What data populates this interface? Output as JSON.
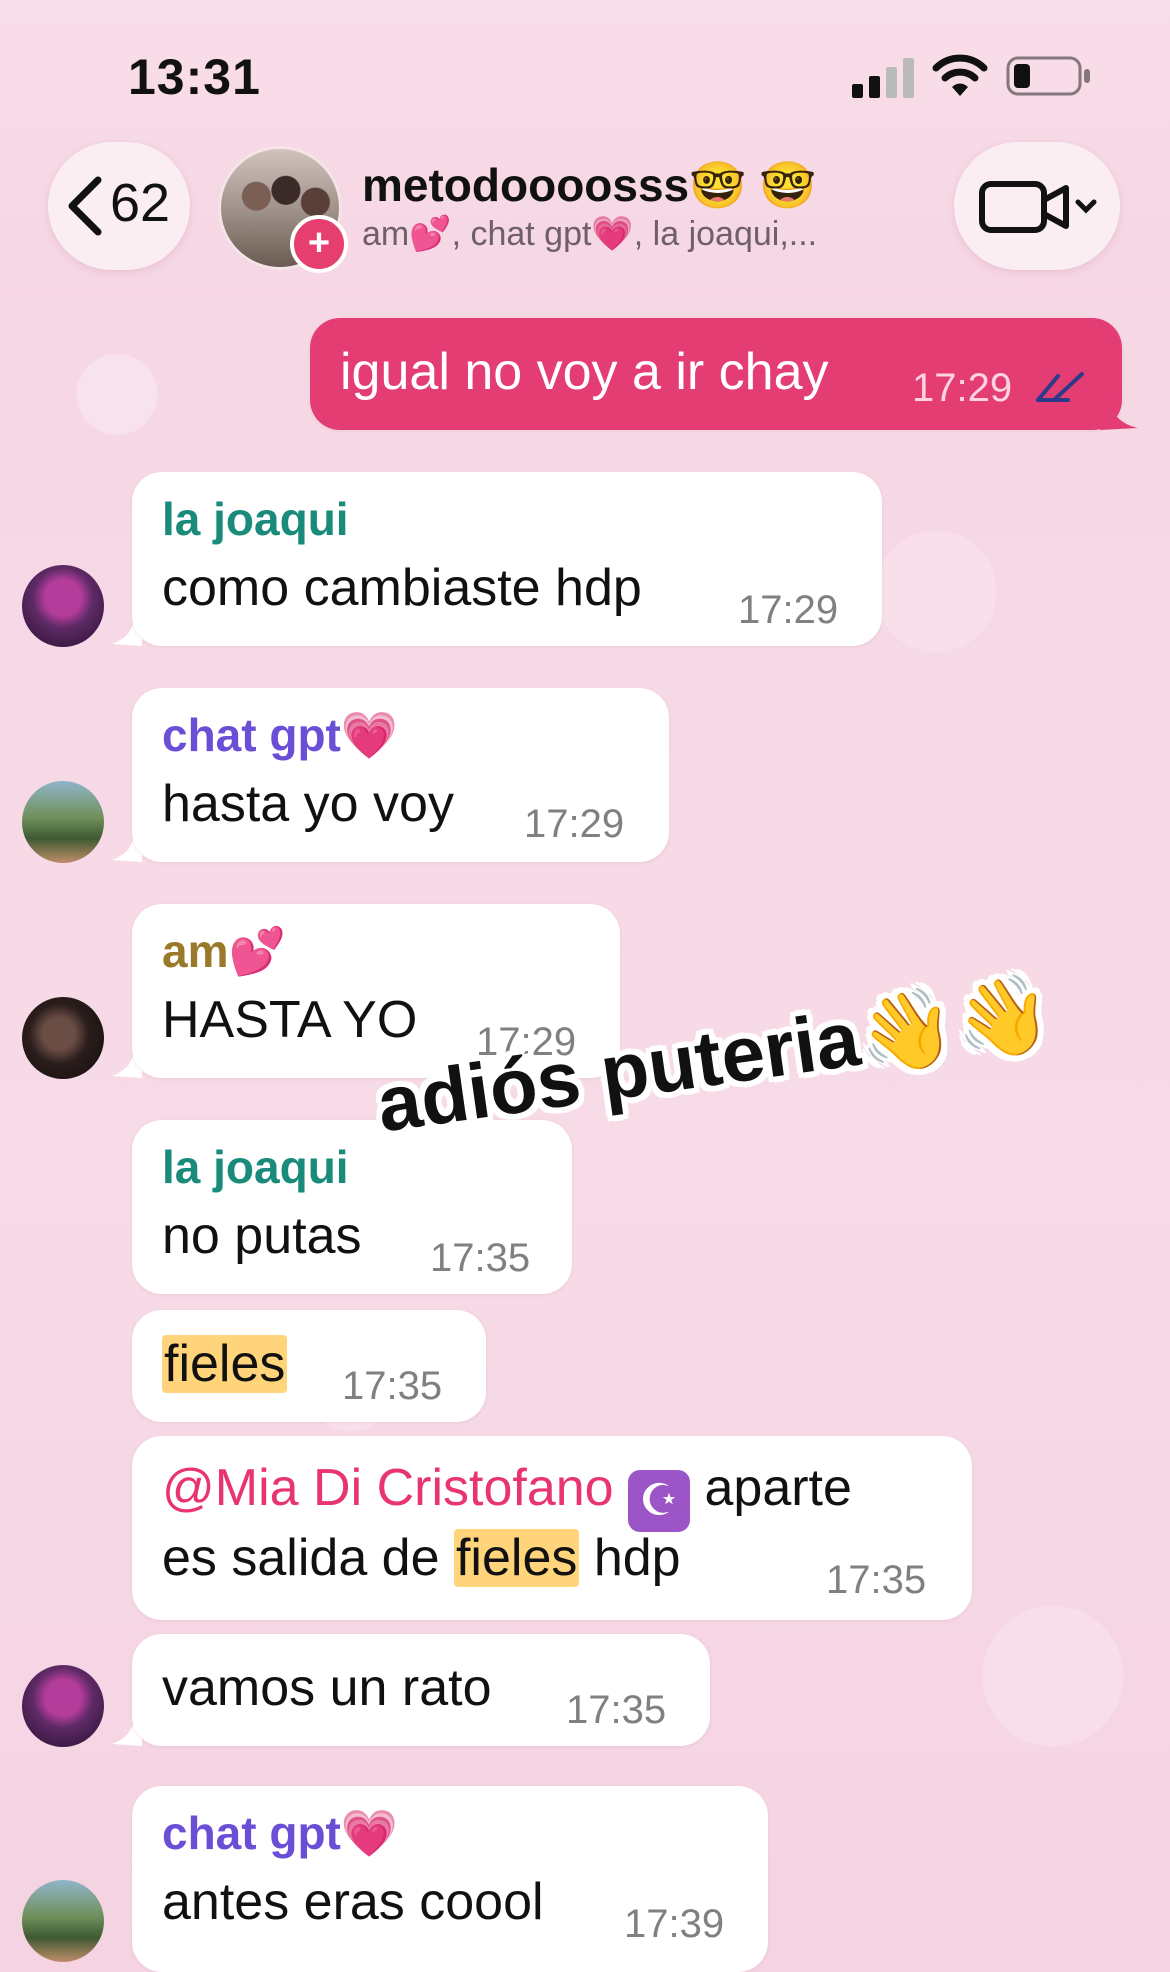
{
  "status_bar": {
    "time": "13:31"
  },
  "header": {
    "back_count": "62",
    "group_name": "metodoooosss🤓 🤓",
    "members": "am💕, chat gpt💗, la joaqui,..."
  },
  "messages": [
    {
      "id": "m1",
      "direction": "out",
      "text": "igual no voy a ir chay",
      "time": "17:29",
      "status": "read"
    },
    {
      "id": "m2",
      "sender": "la joaqui",
      "sender_color": "#1a8a7a",
      "text": "como cambiaste hdp",
      "time": "17:29"
    },
    {
      "id": "m3",
      "sender": "chat gpt💗",
      "sender_color": "#6a4fd6",
      "text": "hasta yo voy",
      "time": "17:29"
    },
    {
      "id": "m4",
      "sender": "am💕",
      "sender_color": "#9a7a2a",
      "text": "HASTA YO",
      "time": "17:29"
    },
    {
      "id": "m5",
      "sender": "la joaqui",
      "sender_color": "#1a8a7a",
      "text": "no putas",
      "time": "17:35"
    },
    {
      "id": "m6",
      "text_highlight": "fieles",
      "time": "17:35"
    },
    {
      "id": "m7",
      "mention": "@Mia Di Cristofano",
      "mention_badge": "☪",
      "line1_rest": "aparte",
      "line2_a": "es salida de",
      "line2_hl": "fieles",
      "line2_b": "hdp",
      "time": "17:35"
    },
    {
      "id": "m8",
      "text": "vamos un rato",
      "time": "17:35"
    },
    {
      "id": "m9",
      "sender": "chat gpt💗",
      "sender_color": "#6a4fd6",
      "text": "antes eras coool",
      "time": "17:39"
    }
  ],
  "sticker": {
    "text": "adiós puteria👋👋"
  },
  "colors": {
    "outgoing_bubble": "#e43d74",
    "highlight": "#ffd47a",
    "mention": "#e8356f"
  },
  "icons": [
    "back-chevron-icon",
    "video-call-icon",
    "signal-icon",
    "wifi-icon",
    "battery-icon",
    "read-receipt-icon"
  ]
}
